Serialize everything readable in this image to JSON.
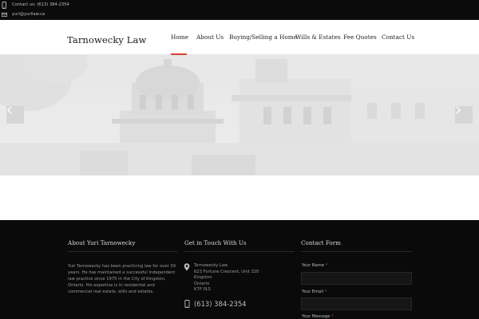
{
  "topbar": {
    "contact": "Contact us: (613) 384-2354",
    "email": "yuri@yurilaw.ca"
  },
  "header": {
    "logo": "Tarnowecky Law",
    "nav": [
      {
        "label": "Home",
        "active": true
      },
      {
        "label": "About Us",
        "active": false
      },
      {
        "label": "Buying/Selling a Home",
        "active": false
      },
      {
        "label": "Wills & Estates",
        "active": false
      },
      {
        "label": "Fee Quotes",
        "active": false
      },
      {
        "label": "Contact Us",
        "active": false
      }
    ],
    "accent": "#d8412f"
  },
  "hero": {
    "prev_icon": "chevron-left-icon",
    "next_icon": "chevron-right-icon"
  },
  "footer": {
    "about": {
      "title": "About Yuri Tarnowecky",
      "text": "Yuri Tarnowecky has been practicing law for over 39 years. He has maintained a successful independent law practice since 1975 in the City of Kingston, Ontario. His expertise is in residential and commercial real estate, wills and estates."
    },
    "contact": {
      "title": "Get in Touch With Us",
      "address": [
        "Tarnowecky Law",
        "623 Fortune Crescent, Unit 320",
        "Kingston",
        "Ontario",
        "K7P 0L5"
      ],
      "phone": "(613) 384-2354"
    },
    "form": {
      "title": "Contact Form",
      "fields": [
        {
          "label": "Your Name",
          "required_mark": "*"
        },
        {
          "label": "Your Email",
          "required_mark": "*"
        },
        {
          "label": "Your Message",
          "required_mark": "*"
        }
      ]
    }
  }
}
